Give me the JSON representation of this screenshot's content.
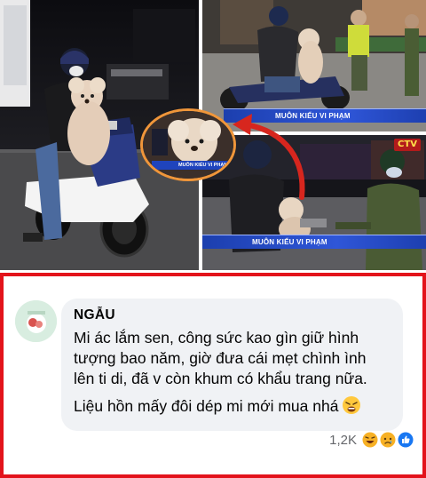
{
  "collage": {
    "news_banner_top": "MUÔN KIỂU VI PHẠM",
    "news_banner_bottom": "MUÔN KIỂU VI PHẠM",
    "zoom_banner": "MUÔN KIỂU VI PHẠM",
    "channel_logo": "CTV",
    "colors": {
      "frame_accent": "#f0963a",
      "news_bar": "#2f56d8",
      "arrow": "#d7261e"
    }
  },
  "comment": {
    "author": "NGẪU",
    "lines": [
      "Mi ác lắm sen, công sức kao gìn giữ hình",
      "tượng bao năm, giờ đưa cái mẹt chình ình",
      "lên ti di, đã v còn khum có khẩu trang nữa.",
      "Liệu hồn mấy đôi dép mi mới mua nhá"
    ],
    "trailing_emoji": "tired-face-emoji",
    "reaction_count": "1,2K",
    "reactions": [
      "haha-icon",
      "sad-icon",
      "like-icon"
    ],
    "frame_color": "#e3131b"
  }
}
